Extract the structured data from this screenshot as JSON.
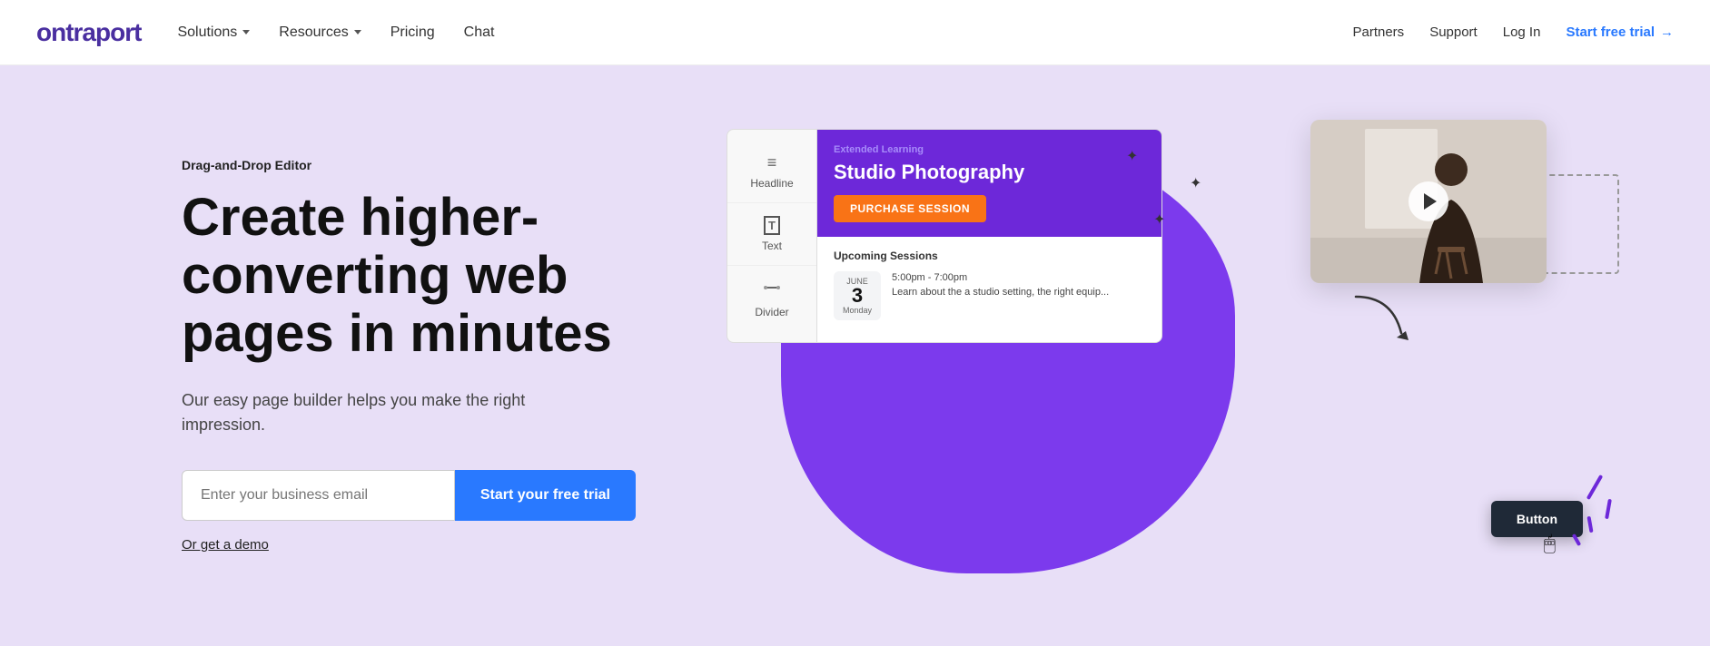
{
  "brand": {
    "logo": "ontraport",
    "logo_color": "#5b21b6"
  },
  "navbar": {
    "solutions_label": "Solutions",
    "resources_label": "Resources",
    "pricing_label": "Pricing",
    "chat_label": "Chat",
    "partners_label": "Partners",
    "support_label": "Support",
    "login_label": "Log In",
    "cta_label": "Start free trial",
    "cta_arrow": "→"
  },
  "hero": {
    "tag": "Drag-and-Drop Editor",
    "title": "Create higher-converting web pages in minutes",
    "subtitle": "Our easy page builder helps you make the right impression.",
    "email_placeholder": "Enter your business email",
    "cta_button": "Start your free trial",
    "demo_link": "Or get a demo"
  },
  "editor_mock": {
    "sidebar": {
      "items": [
        {
          "icon": "≡",
          "label": "Headline"
        },
        {
          "icon": "T",
          "label": "Text"
        },
        {
          "icon": "◻",
          "label": "Divider"
        }
      ]
    },
    "canvas": {
      "badge": "Extended Learning",
      "title": "Studio Photography",
      "purchase_btn": "PURCHASE SESSION",
      "sessions_heading": "Upcoming Sessions",
      "session": {
        "month": "June",
        "day": "3",
        "dow": "Monday",
        "time": "5:00pm - 7:00pm",
        "description": "Learn about the a studio setting, the right equip..."
      }
    },
    "floating_button": "Button"
  }
}
